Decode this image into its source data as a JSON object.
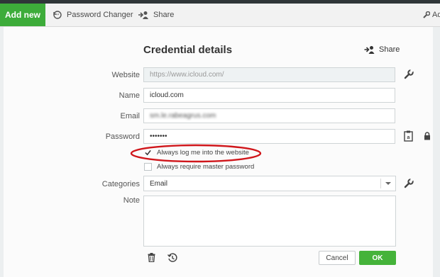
{
  "toolbar": {
    "add_new": "Add new",
    "password_changer": "Password Changer",
    "share": "Share",
    "admin_truncated": "Ad"
  },
  "dialog": {
    "title": "Credential details",
    "share": "Share"
  },
  "form": {
    "website": {
      "label": "Website",
      "value": "https://www.icloud.com/"
    },
    "name": {
      "label": "Name",
      "value": "icloud.com"
    },
    "email": {
      "label": "Email",
      "value": "sm.le.rabeagrus.com"
    },
    "password": {
      "label": "Password",
      "value": "•••••••"
    },
    "always_login": {
      "label": "Always log me into the website",
      "checked": true
    },
    "require_master": {
      "label": "Always require master password",
      "checked": false
    },
    "categories": {
      "label": "Categories",
      "value": "Email"
    },
    "note": {
      "label": "Note",
      "value": ""
    }
  },
  "buttons": {
    "cancel": "Cancel",
    "ok": "OK"
  },
  "colors": {
    "accent_green": "#3dac3a",
    "highlight_red": "#d0161b"
  }
}
